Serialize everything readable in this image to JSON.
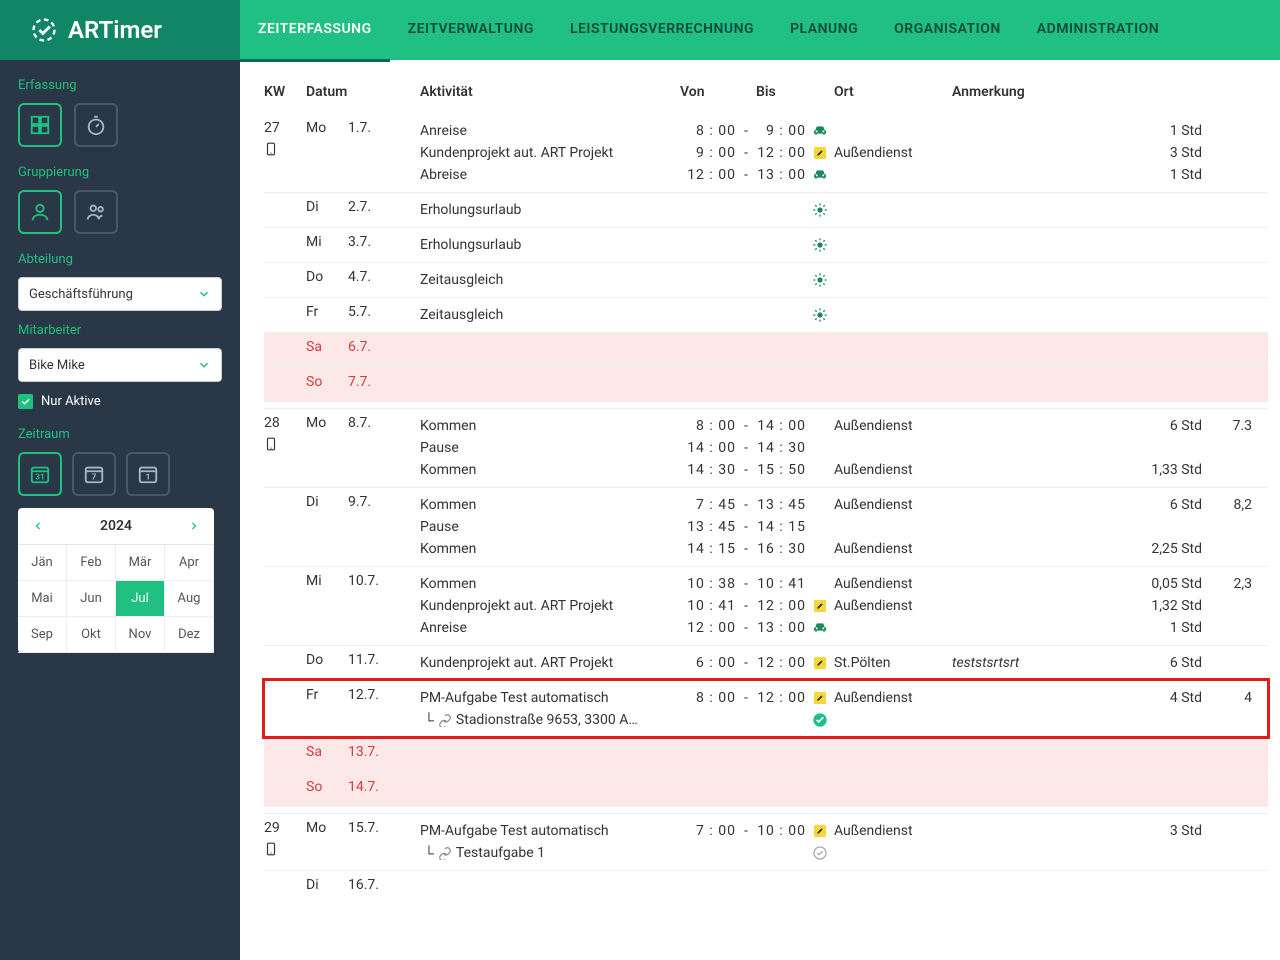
{
  "brand": "ARTimer",
  "nav": [
    "ZEITERFASSUNG",
    "ZEITVERWALTUNG",
    "LEISTUNGSVERRECHNUNG",
    "PLANUNG",
    "ORGANISATION",
    "ADMINISTRATION"
  ],
  "navActive": 0,
  "sidebar": {
    "erfassung": "Erfassung",
    "gruppierung": "Gruppierung",
    "abteilung": "Abteilung",
    "abteilungValue": "Geschäftsführung",
    "mitarbeiter": "Mitarbeiter",
    "mitarbeiterValue": "Bike Mike",
    "nurAktive": "Nur Aktive",
    "zeitraum": "Zeitraum",
    "year": "2024",
    "months": [
      "Jän",
      "Feb",
      "Mär",
      "Apr",
      "Mai",
      "Jun",
      "Jul",
      "Aug",
      "Sep",
      "Okt",
      "Nov",
      "Dez"
    ],
    "monthActive": 6
  },
  "headers": {
    "kw": "KW",
    "datum": "Datum",
    "aktivitaet": "Aktivität",
    "von": "Von",
    "bis": "Bis",
    "ort": "Ort",
    "anmerkung": "Anmerkung"
  },
  "weeks": [
    {
      "kw": "27",
      "phone": true,
      "days": [
        {
          "wd": "Mo",
          "date": "1.7.",
          "entries": [
            {
              "activity": "Anreise",
              "von": "8 : 00",
              "bis": "9 : 00",
              "icon": "car",
              "ort": "",
              "note": "",
              "dur": "1 Std"
            },
            {
              "activity": "Kundenprojekt aut. ART Projekt",
              "von": "9 : 00",
              "bis": "12 : 00",
              "icon": "edit",
              "ort": "Außendienst",
              "note": "",
              "dur": "3 Std"
            },
            {
              "activity": "Abreise",
              "von": "12 : 00",
              "bis": "13 : 00",
              "icon": "car",
              "ort": "",
              "note": "",
              "dur": "1 Std"
            }
          ]
        },
        {
          "wd": "Di",
          "date": "2.7.",
          "entries": [
            {
              "activity": "Erholungsurlaub",
              "icon": "sun"
            }
          ]
        },
        {
          "wd": "Mi",
          "date": "3.7.",
          "entries": [
            {
              "activity": "Erholungsurlaub",
              "icon": "sun"
            }
          ]
        },
        {
          "wd": "Do",
          "date": "4.7.",
          "entries": [
            {
              "activity": "Zeitausgleich",
              "icon": "sun"
            }
          ]
        },
        {
          "wd": "Fr",
          "date": "5.7.",
          "entries": [
            {
              "activity": "Zeitausgleich",
              "icon": "sun"
            }
          ]
        },
        {
          "wd": "Sa",
          "date": "6.7.",
          "weekend": true,
          "entries": []
        },
        {
          "wd": "So",
          "date": "7.7.",
          "weekend": true,
          "entries": []
        }
      ]
    },
    {
      "kw": "28",
      "phone": true,
      "days": [
        {
          "wd": "Mo",
          "date": "8.7.",
          "ext": "7.3",
          "entries": [
            {
              "activity": "Kommen",
              "von": "8 : 00",
              "bis": "14 : 00",
              "ort": "Außendienst",
              "dur": "6 Std"
            },
            {
              "activity": "Pause",
              "von": "14 : 00",
              "bis": "14 : 30"
            },
            {
              "activity": "Kommen",
              "von": "14 : 30",
              "bis": "15 : 50",
              "ort": "Außendienst",
              "dur": "1,33 Std"
            }
          ]
        },
        {
          "wd": "Di",
          "date": "9.7.",
          "ext": "8,2",
          "entries": [
            {
              "activity": "Kommen",
              "von": "7 : 45",
              "bis": "13 : 45",
              "ort": "Außendienst",
              "dur": "6 Std"
            },
            {
              "activity": "Pause",
              "von": "13 : 45",
              "bis": "14 : 15"
            },
            {
              "activity": "Kommen",
              "von": "14 : 15",
              "bis": "16 : 30",
              "ort": "Außendienst",
              "dur": "2,25 Std"
            }
          ]
        },
        {
          "wd": "Mi",
          "date": "10.7.",
          "ext": "2,3",
          "entries": [
            {
              "activity": "Kommen",
              "von": "10 : 38",
              "bis": "10 : 41",
              "ort": "Außendienst",
              "dur": "0,05 Std"
            },
            {
              "activity": "Kundenprojekt aut. ART Projekt",
              "von": "10 : 41",
              "bis": "12 : 00",
              "icon": "edit",
              "ort": "Außendienst",
              "dur": "1,32 Std"
            },
            {
              "activity": "Anreise",
              "von": "12 : 00",
              "bis": "13 : 00",
              "icon": "car",
              "dur": "1 Std"
            }
          ]
        },
        {
          "wd": "Do",
          "date": "11.7.",
          "entries": [
            {
              "activity": "Kundenprojekt aut. ART Projekt",
              "von": "6 : 00",
              "bis": "12 : 00",
              "icon": "edit",
              "ort": "St.Pölten",
              "note": "teststsrtsrt",
              "noteItalic": true,
              "dur": "6 Std"
            }
          ]
        },
        {
          "wd": "Fr",
          "date": "12.7.",
          "highlight": true,
          "ext": "4",
          "entries": [
            {
              "activity": "PM-Aufgabe Test automatisch",
              "von": "8 : 00",
              "bis": "12 : 00",
              "icon": "edit",
              "ort": "Außendienst",
              "dur": "4 Std",
              "sub": "Stadionstraße 9653, 3300 A…",
              "subicon": "check"
            }
          ]
        },
        {
          "wd": "Sa",
          "date": "13.7.",
          "weekend": true,
          "entries": []
        },
        {
          "wd": "So",
          "date": "14.7.",
          "weekend": true,
          "entries": []
        }
      ]
    },
    {
      "kw": "29",
      "phone": true,
      "days": [
        {
          "wd": "Mo",
          "date": "15.7.",
          "entries": [
            {
              "activity": "PM-Aufgabe Test automatisch",
              "von": "7 : 00",
              "bis": "10 : 00",
              "icon": "edit",
              "ort": "Außendienst",
              "dur": "3 Std",
              "sub": "Testaufgabe 1",
              "subicon": "check-gray"
            }
          ]
        },
        {
          "wd": "Di",
          "date": "16.7.",
          "entries": []
        }
      ]
    }
  ]
}
